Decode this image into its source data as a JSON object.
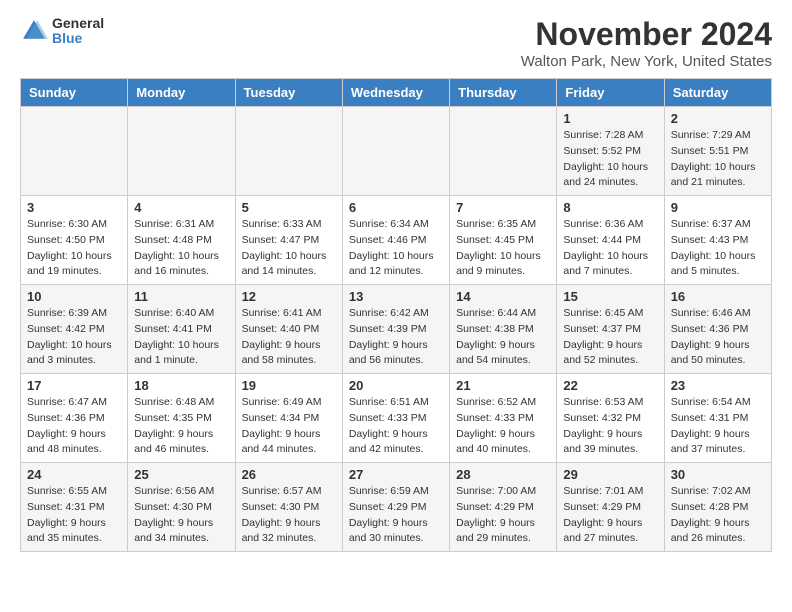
{
  "logo": {
    "general": "General",
    "blue": "Blue"
  },
  "title": "November 2024",
  "location": "Walton Park, New York, United States",
  "days_of_week": [
    "Sunday",
    "Monday",
    "Tuesday",
    "Wednesday",
    "Thursday",
    "Friday",
    "Saturday"
  ],
  "weeks": [
    [
      {
        "day": "",
        "info": ""
      },
      {
        "day": "",
        "info": ""
      },
      {
        "day": "",
        "info": ""
      },
      {
        "day": "",
        "info": ""
      },
      {
        "day": "",
        "info": ""
      },
      {
        "day": "1",
        "info": "Sunrise: 7:28 AM\nSunset: 5:52 PM\nDaylight: 10 hours\nand 24 minutes."
      },
      {
        "day": "2",
        "info": "Sunrise: 7:29 AM\nSunset: 5:51 PM\nDaylight: 10 hours\nand 21 minutes."
      }
    ],
    [
      {
        "day": "3",
        "info": "Sunrise: 6:30 AM\nSunset: 4:50 PM\nDaylight: 10 hours\nand 19 minutes."
      },
      {
        "day": "4",
        "info": "Sunrise: 6:31 AM\nSunset: 4:48 PM\nDaylight: 10 hours\nand 16 minutes."
      },
      {
        "day": "5",
        "info": "Sunrise: 6:33 AM\nSunset: 4:47 PM\nDaylight: 10 hours\nand 14 minutes."
      },
      {
        "day": "6",
        "info": "Sunrise: 6:34 AM\nSunset: 4:46 PM\nDaylight: 10 hours\nand 12 minutes."
      },
      {
        "day": "7",
        "info": "Sunrise: 6:35 AM\nSunset: 4:45 PM\nDaylight: 10 hours\nand 9 minutes."
      },
      {
        "day": "8",
        "info": "Sunrise: 6:36 AM\nSunset: 4:44 PM\nDaylight: 10 hours\nand 7 minutes."
      },
      {
        "day": "9",
        "info": "Sunrise: 6:37 AM\nSunset: 4:43 PM\nDaylight: 10 hours\nand 5 minutes."
      }
    ],
    [
      {
        "day": "10",
        "info": "Sunrise: 6:39 AM\nSunset: 4:42 PM\nDaylight: 10 hours\nand 3 minutes."
      },
      {
        "day": "11",
        "info": "Sunrise: 6:40 AM\nSunset: 4:41 PM\nDaylight: 10 hours\nand 1 minute."
      },
      {
        "day": "12",
        "info": "Sunrise: 6:41 AM\nSunset: 4:40 PM\nDaylight: 9 hours\nand 58 minutes."
      },
      {
        "day": "13",
        "info": "Sunrise: 6:42 AM\nSunset: 4:39 PM\nDaylight: 9 hours\nand 56 minutes."
      },
      {
        "day": "14",
        "info": "Sunrise: 6:44 AM\nSunset: 4:38 PM\nDaylight: 9 hours\nand 54 minutes."
      },
      {
        "day": "15",
        "info": "Sunrise: 6:45 AM\nSunset: 4:37 PM\nDaylight: 9 hours\nand 52 minutes."
      },
      {
        "day": "16",
        "info": "Sunrise: 6:46 AM\nSunset: 4:36 PM\nDaylight: 9 hours\nand 50 minutes."
      }
    ],
    [
      {
        "day": "17",
        "info": "Sunrise: 6:47 AM\nSunset: 4:36 PM\nDaylight: 9 hours\nand 48 minutes."
      },
      {
        "day": "18",
        "info": "Sunrise: 6:48 AM\nSunset: 4:35 PM\nDaylight: 9 hours\nand 46 minutes."
      },
      {
        "day": "19",
        "info": "Sunrise: 6:49 AM\nSunset: 4:34 PM\nDaylight: 9 hours\nand 44 minutes."
      },
      {
        "day": "20",
        "info": "Sunrise: 6:51 AM\nSunset: 4:33 PM\nDaylight: 9 hours\nand 42 minutes."
      },
      {
        "day": "21",
        "info": "Sunrise: 6:52 AM\nSunset: 4:33 PM\nDaylight: 9 hours\nand 40 minutes."
      },
      {
        "day": "22",
        "info": "Sunrise: 6:53 AM\nSunset: 4:32 PM\nDaylight: 9 hours\nand 39 minutes."
      },
      {
        "day": "23",
        "info": "Sunrise: 6:54 AM\nSunset: 4:31 PM\nDaylight: 9 hours\nand 37 minutes."
      }
    ],
    [
      {
        "day": "24",
        "info": "Sunrise: 6:55 AM\nSunset: 4:31 PM\nDaylight: 9 hours\nand 35 minutes."
      },
      {
        "day": "25",
        "info": "Sunrise: 6:56 AM\nSunset: 4:30 PM\nDaylight: 9 hours\nand 34 minutes."
      },
      {
        "day": "26",
        "info": "Sunrise: 6:57 AM\nSunset: 4:30 PM\nDaylight: 9 hours\nand 32 minutes."
      },
      {
        "day": "27",
        "info": "Sunrise: 6:59 AM\nSunset: 4:29 PM\nDaylight: 9 hours\nand 30 minutes."
      },
      {
        "day": "28",
        "info": "Sunrise: 7:00 AM\nSunset: 4:29 PM\nDaylight: 9 hours\nand 29 minutes."
      },
      {
        "day": "29",
        "info": "Sunrise: 7:01 AM\nSunset: 4:29 PM\nDaylight: 9 hours\nand 27 minutes."
      },
      {
        "day": "30",
        "info": "Sunrise: 7:02 AM\nSunset: 4:28 PM\nDaylight: 9 hours\nand 26 minutes."
      }
    ]
  ]
}
